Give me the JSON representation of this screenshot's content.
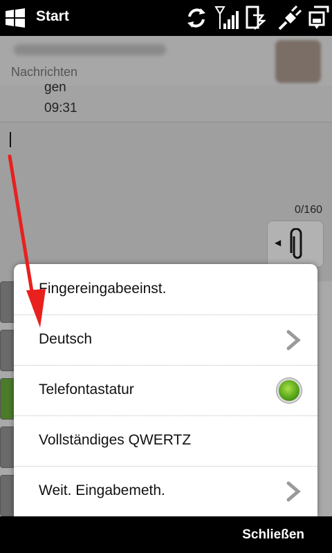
{
  "statusbar": {
    "title": "Start",
    "icons": [
      "windows-logo-icon",
      "sync-icon",
      "signal-icon",
      "data-connection-icon",
      "charging-icon",
      "battery-icon"
    ]
  },
  "conversation": {
    "contact_sub": "Nachrichten",
    "last_message_text": "gen",
    "last_message_time": "09:31",
    "char_count": "0/160"
  },
  "menu": {
    "items": [
      {
        "label": "Fingereingabeeinst.",
        "control": "none"
      },
      {
        "label": "Deutsch",
        "control": "chevron-right-icon"
      },
      {
        "label": "Telefontastatur",
        "control": "radio-selected"
      },
      {
        "label": "Vollständiges QWERTZ",
        "control": "none"
      },
      {
        "label": "Weit. Eingabemeth.",
        "control": "chevron-right-icon"
      }
    ]
  },
  "bottombar": {
    "close_label": "Schließen"
  },
  "colors": {
    "annotation_arrow": "#e8201e",
    "radio_selected": "#5aa81a"
  }
}
